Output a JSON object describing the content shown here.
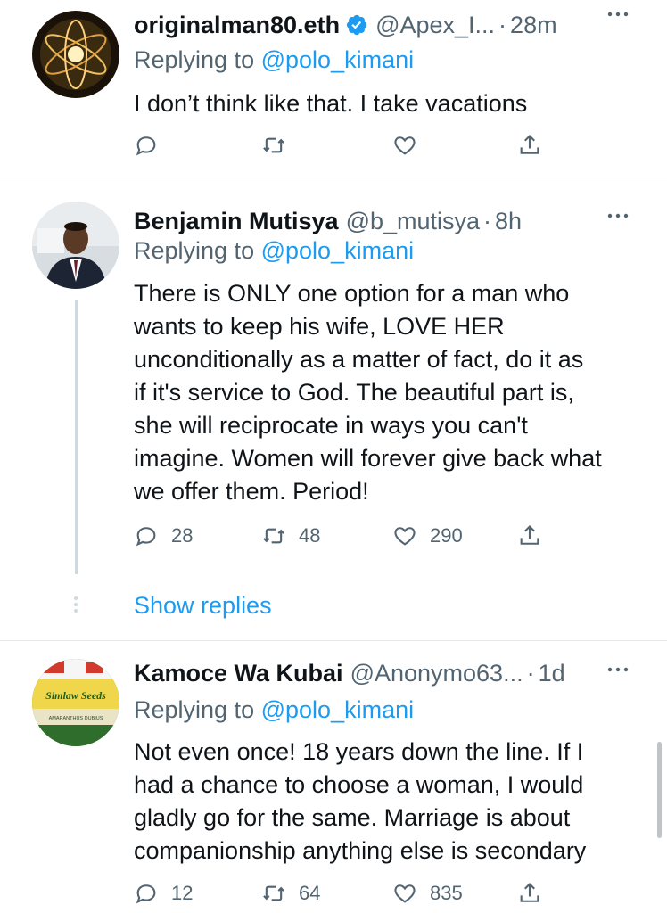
{
  "tweets": [
    {
      "name": "originalman80.eth",
      "verified": true,
      "handle": "@Apex_I...",
      "time": "28m",
      "replying_label": "Replying to",
      "replying_to": "@polo_kimani",
      "text": "I don’t think like that. I take vacations",
      "replies": "",
      "retweets": "",
      "likes": ""
    },
    {
      "name": "Benjamin Mutisya",
      "verified": false,
      "handle": "@b_mutisya",
      "time": "8h",
      "replying_label": "Replying to",
      "replying_to": "@polo_kimani",
      "text": "There is ONLY one option for a man who\nwants to keep his wife, LOVE HER\nunconditionally as a matter of fact, do it as\nif it's service to God. The beautiful part is,\nshe will reciprocate in ways you can't\nimagine. Women will forever give back what\nwe offer them. Period!",
      "replies": "28",
      "retweets": "48",
      "likes": "290"
    },
    {
      "name": "Kamoce Wa Kubai",
      "verified": false,
      "handle": "@Anonymo63...",
      "time": "1d",
      "replying_label": "Replying to",
      "replying_to": "@polo_kimani",
      "text": "Not even once! 18 years down the line. If I\nhad a chance to choose a woman, I would\ngladly go for the same. Marriage is about\ncompanionship anything else is secondary",
      "replies": "12",
      "retweets": "64",
      "likes": "835",
      "avatar_text": {
        "brand": "Simlaw Seeds",
        "product": "AMARANTHUS DUBIUS"
      }
    }
  ],
  "show_replies": "Show replies",
  "colors": {
    "accent": "#1d9bf0",
    "secondary_text": "#536471",
    "primary_text": "#0f1419",
    "divider": "#e6e9ec"
  }
}
